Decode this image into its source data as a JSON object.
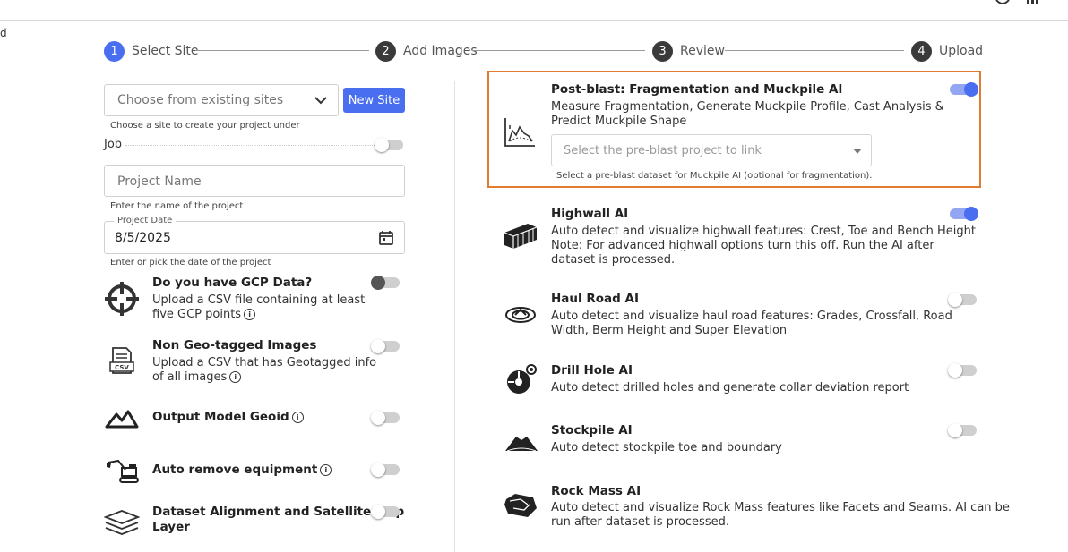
{
  "stray_text": "d",
  "stepper": [
    {
      "num": "1",
      "label": "Select Site"
    },
    {
      "num": "2",
      "label": "Add Images"
    },
    {
      "num": "3",
      "label": "Review"
    },
    {
      "num": "4",
      "label": "Upload"
    }
  ],
  "site": {
    "placeholder": "Choose from existing sites",
    "new_site_label": "New Site",
    "helper": "Choose a site to create your project under"
  },
  "job": {
    "label": "Job",
    "enabled": false
  },
  "project_name": {
    "placeholder": "Project Name",
    "helper": "Enter the name of the project"
  },
  "project_date": {
    "label": "Project Date",
    "value": "8/5/2025",
    "helper": "Enter or pick the date of the project"
  },
  "options": [
    {
      "title": "Do you have GCP Data?",
      "desc": [
        "Upload a CSV file containing at least",
        "five GCP points"
      ],
      "info": true,
      "enabled": false,
      "icon": "crosshair-icon"
    },
    {
      "title": "Non Geo-tagged Images",
      "desc": [
        "Upload a CSV that has Geotagged info",
        "of all images"
      ],
      "info": true,
      "enabled": false,
      "icon": "csv-file-icon"
    },
    {
      "title": "Output Model Geoid",
      "desc": [],
      "info": true,
      "enabled": false,
      "icon": "mountain-icon"
    },
    {
      "title": "Auto remove equipment",
      "desc": [],
      "info": true,
      "enabled": false,
      "icon": "excavator-icon"
    },
    {
      "title": "Dataset Alignment and Satellite Map",
      "title2": "Layer",
      "desc": [],
      "info": false,
      "enabled": false,
      "icon": "layers-icon"
    }
  ],
  "ai_features": [
    {
      "title": "Post-blast: Fragmentation and Muckpile AI",
      "desc": [
        "Measure Fragmentation, Generate Muckpile Profile, Cast Analysis &",
        "Predict Muckpile Shape"
      ],
      "enabled": true,
      "icon": "muckpile-chart-icon",
      "link_placeholder": "Select the pre-blast project to link",
      "link_helper": "Select a pre-blast dataset for Muckpile AI (optional for fragmentation)."
    },
    {
      "title": "Highwall AI",
      "desc": [
        "Auto detect and visualize highwall features: Crest, Toe and Bench Height",
        "Note: For advanced highwall options turn this off. Run the AI after",
        "dataset is processed."
      ],
      "enabled": true,
      "icon": "highwall-icon"
    },
    {
      "title": "Haul Road AI",
      "desc": [
        "Auto detect and visualize haul road features: Grades, Crossfall, Road",
        "Width, Berm Height and Super Elevation"
      ],
      "enabled": false,
      "icon": "haul-road-icon"
    },
    {
      "title": "Drill Hole AI",
      "desc": [
        "Auto detect drilled holes and generate collar deviation report"
      ],
      "enabled": false,
      "icon": "drill-hole-icon"
    },
    {
      "title": "Stockpile AI",
      "desc": [
        "Auto detect stockpile toe and boundary"
      ],
      "enabled": false,
      "icon": "stockpile-icon"
    },
    {
      "title": "Rock Mass AI",
      "desc": [
        "Auto detect and visualize Rock Mass features like Facets and Seams. AI can be",
        "run after dataset is processed."
      ],
      "enabled": false,
      "icon": "rock-mass-icon"
    }
  ],
  "colors": {
    "accent": "#4a6ef0",
    "highlight_border": "#e07b32",
    "step_idle": "#3a3a3a"
  }
}
